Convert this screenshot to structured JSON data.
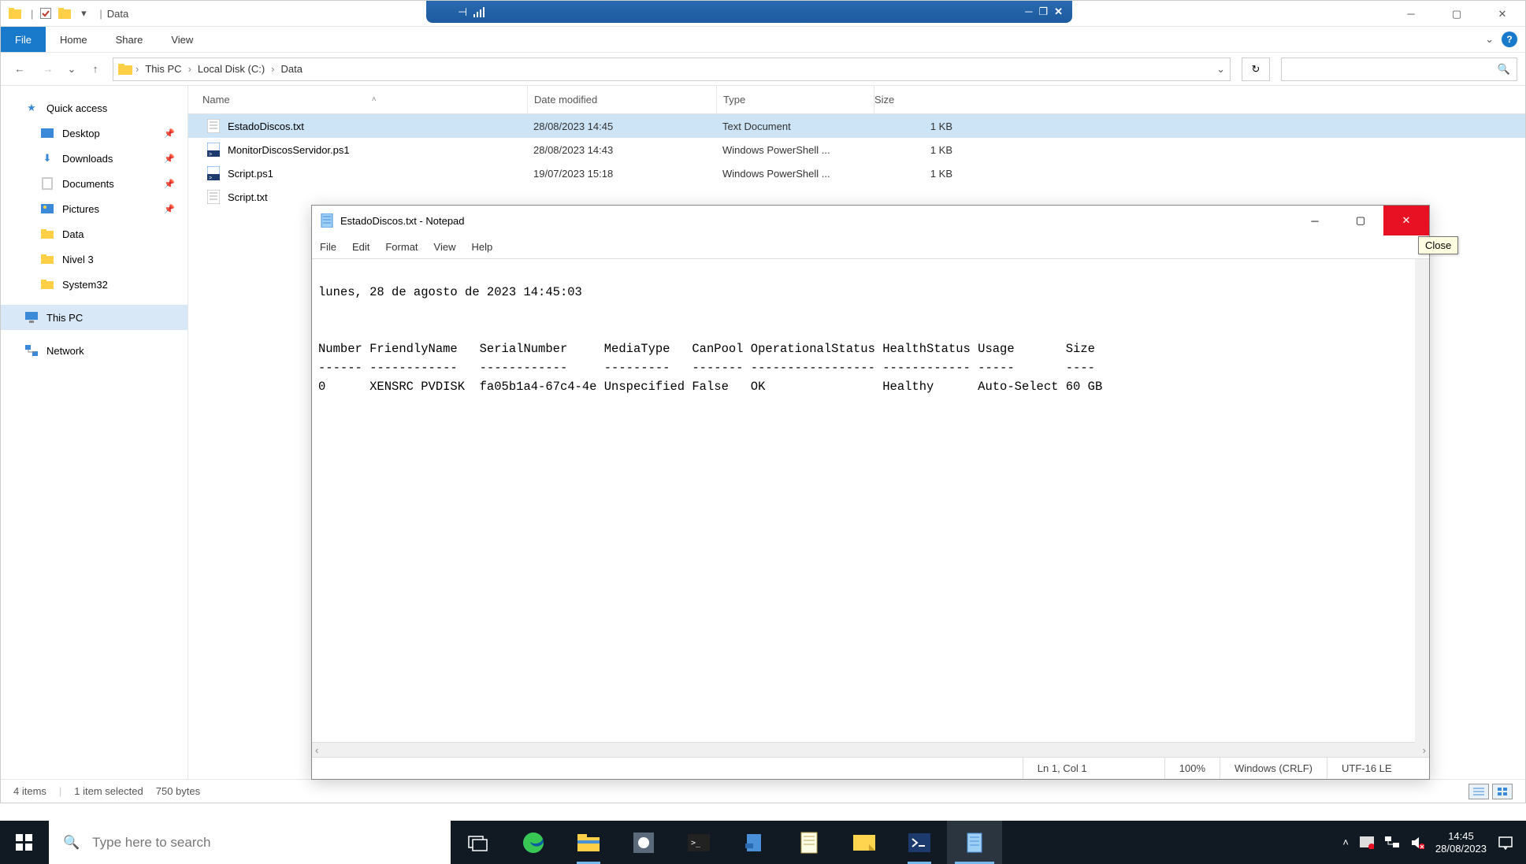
{
  "explorer": {
    "title": "Data",
    "ribbon": {
      "file": "File",
      "home": "Home",
      "share": "Share",
      "view": "View"
    },
    "breadcrumb": {
      "c0": "This PC",
      "c1": "Local Disk (C:)",
      "c2": "Data"
    },
    "columns": {
      "name": "Name",
      "date": "Date modified",
      "type": "Type",
      "size": "Size"
    },
    "sidebar": {
      "quick": "Quick access",
      "desktop": "Desktop",
      "downloads": "Downloads",
      "documents": "Documents",
      "pictures": "Pictures",
      "data": "Data",
      "nivel3": "Nivel 3",
      "system32": "System32",
      "thispc": "This PC",
      "network": "Network"
    },
    "files": [
      {
        "name": "EstadoDiscos.txt",
        "date": "28/08/2023 14:45",
        "type": "Text Document",
        "size": "1 KB",
        "selected": true,
        "icon": "txt"
      },
      {
        "name": "MonitorDiscosServidor.ps1",
        "date": "28/08/2023 14:43",
        "type": "Windows PowerShell ...",
        "size": "1 KB",
        "icon": "ps1"
      },
      {
        "name": "Script.ps1",
        "date": "19/07/2023 15:18",
        "type": "Windows PowerShell ...",
        "size": "1 KB",
        "icon": "ps1"
      },
      {
        "name": "Script.txt",
        "date": "",
        "type": "",
        "size": "",
        "icon": "txt"
      }
    ],
    "status": {
      "items": "4 items",
      "selected": "1 item selected",
      "bytes": "750 bytes"
    }
  },
  "notepad": {
    "title": "EstadoDiscos.txt - Notepad",
    "menu": {
      "file": "File",
      "edit": "Edit",
      "format": "Format",
      "view": "View",
      "help": "Help"
    },
    "content": "\nlunes, 28 de agosto de 2023 14:45:03\n\n\nNumber FriendlyName   SerialNumber     MediaType   CanPool OperationalStatus HealthStatus Usage       Size\n------ ------------   ------------     ---------   ------- ----------------- ------------ -----       ----\n0      XENSRC PVDISK  fa05b1a4-67c4-4e Unspecified False   OK                Healthy      Auto-Select 60 GB",
    "status": {
      "pos": "Ln 1, Col 1",
      "zoom": "100%",
      "eol": "Windows (CRLF)",
      "enc": "UTF-16 LE"
    },
    "tooltip": "Close"
  },
  "taskbar": {
    "search": "Type here to search",
    "time": "14:45",
    "date": "28/08/2023"
  }
}
